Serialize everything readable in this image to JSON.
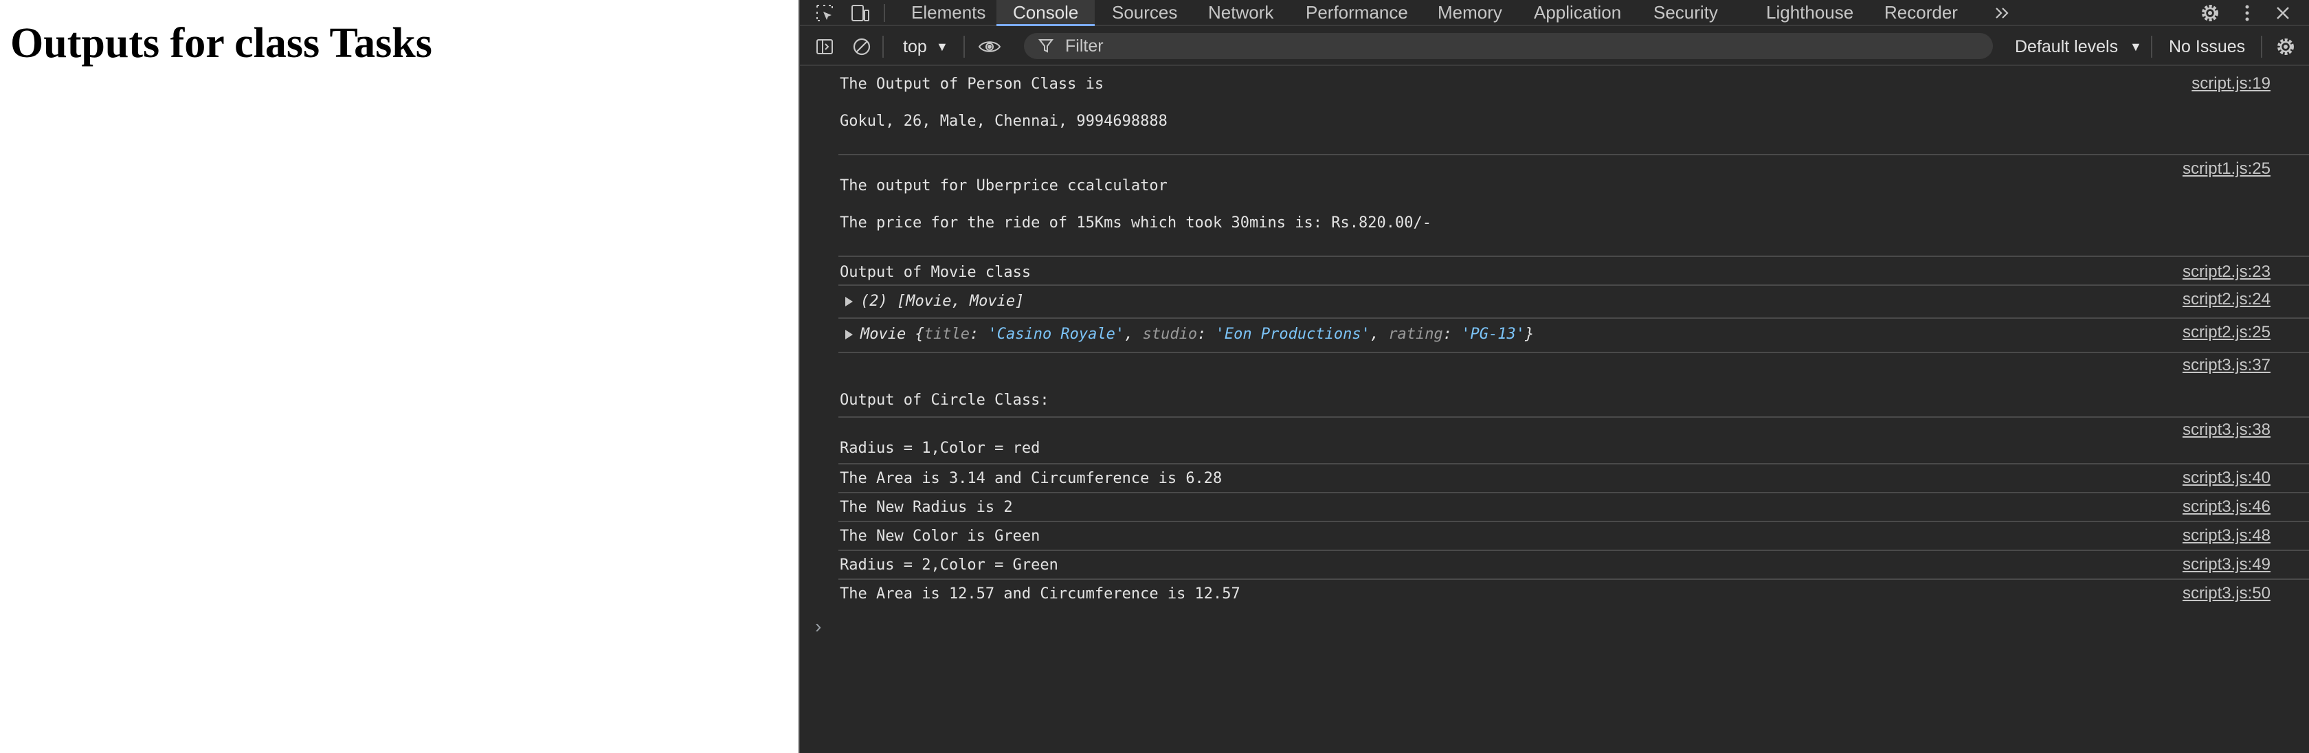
{
  "page": {
    "heading": "Outputs for class Tasks"
  },
  "devtools": {
    "tabs": [
      "Elements",
      "Console",
      "Sources",
      "Network",
      "Performance",
      "Memory",
      "Application",
      "Security",
      "Lighthouse",
      "Recorder"
    ],
    "active_tab": "Console",
    "context": "top",
    "filter_placeholder": "Filter",
    "levels": "Default levels",
    "issues": "No Issues",
    "accent_color": "#7cacf8"
  },
  "console": {
    "messages": [
      {
        "lines": [
          "The Output of Person Class is",
          "Gokul, 26, Male, Chennai, 9994698888"
        ],
        "source": "script.js:19"
      },
      {
        "lines": [
          "The output for Uberprice ccalculator",
          "The price for the ride of 15Kms which took 30mins is: Rs.820.00/-"
        ],
        "source": "script1.js:25"
      },
      {
        "text": "Output of Movie class",
        "source": "script2.js:23"
      },
      {
        "text": "(2) [Movie, Movie]",
        "source": "script2.js:24"
      },
      {
        "object": {
          "class": "Movie",
          "props": [
            {
              "key": "title",
              "value": "'Casino Royale'"
            },
            {
              "key": "studio",
              "value": "'Eon Productions'"
            },
            {
              "key": "rating",
              "value": "'PG-13'"
            }
          ]
        },
        "source": "script2.js:25"
      },
      {
        "text": "Output of Circle Class:",
        "source": "script3.js:37"
      },
      {
        "text": "Radius = 1,Color = red",
        "source": "script3.js:38"
      },
      {
        "text": "The Area is 3.14 and Circumference is 6.28",
        "source": "script3.js:40"
      },
      {
        "text": "The New Radius is 2",
        "source": "script3.js:46"
      },
      {
        "text": "The New Color is Green",
        "source": "script3.js:48"
      },
      {
        "text": "Radius = 2,Color = Green",
        "source": "script3.js:49"
      },
      {
        "text": "The Area is 12.57 and Circumference is 12.57",
        "source": "script3.js:50"
      }
    ]
  }
}
